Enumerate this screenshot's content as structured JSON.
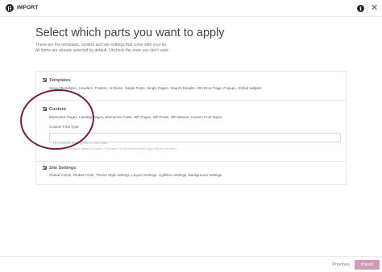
{
  "header": {
    "title": "IMPORT",
    "logo_icon": "elementor-logo-icon",
    "info_icon_glyph": "i",
    "close_icon_glyph": "✕"
  },
  "main": {
    "heading": "Select which parts you want to apply",
    "description_line1": "These are the templates, content and site settings that come with your kit.",
    "description_line2": "All items are already selected by default. Uncheck the ones you don't want."
  },
  "sections": {
    "templates": {
      "title": "Templates",
      "items": "Saved Templates, Headers, Footers, Archives, Single Posts, Single Pages, Search Results, 404 Error Page, Popups, Global widgets",
      "checked": true
    },
    "content": {
      "title": "Content",
      "items": "Elementor Pages, Landing Pages, Elementor Posts, WP Pages, WP Posts, WP Menus, Custom Post Types",
      "checked": true,
      "custom_post_type_label": "Custom Post Type",
      "custom_post_type_placeholder": "No custom post types in your site...",
      "custom_post_type_value": "",
      "help_text": "Add the custom posts types to export. The latest 20 items from each type will be included."
    },
    "site_settings": {
      "title": "Site Settings",
      "items": "Global Colors, Global Fonts, Theme Style settings, Layout Settings, Lightbox Settings, Background Settings",
      "checked": true
    }
  },
  "footer": {
    "previous_label": "Previous",
    "import_label": "Import"
  },
  "colors": {
    "import_button": "#d29ab4",
    "annotation_circle": "#7a1a45",
    "checkbox": "#515962"
  }
}
